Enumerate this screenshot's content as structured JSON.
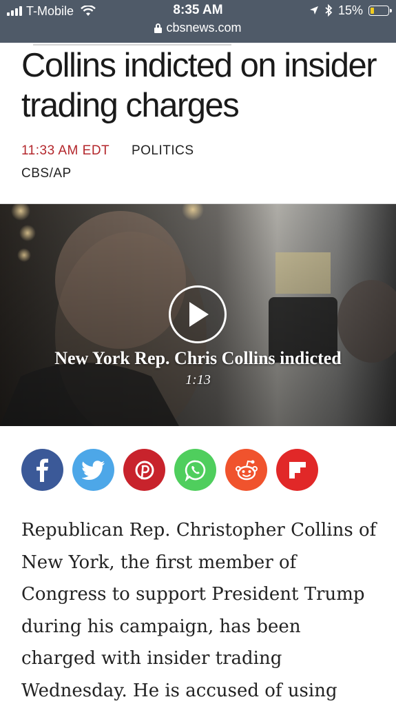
{
  "status_bar": {
    "carrier": "T-Mobile",
    "time": "8:35 AM",
    "url": "cbsnews.com",
    "battery_percent": "15%",
    "battery_level": 0.15,
    "icons": [
      "signal-icon",
      "wifi-icon",
      "lock-icon",
      "location-arrow-icon",
      "bluetooth-icon",
      "battery-icon"
    ]
  },
  "article": {
    "headline": "Collins indicted on insider trading charges",
    "time": "11:33 AM EDT",
    "category": "POLITICS",
    "source": "CBS/AP",
    "body": "Republican Rep. Christopher Collins of New York, the first member of Congress to support President Trump during his campaign, has been charged with insider trading Wednesday. He is accused of using"
  },
  "video": {
    "title": "New York Rep. Chris Collins indicted",
    "duration": "1:13"
  },
  "share": [
    {
      "network": "facebook",
      "icon": "facebook-icon",
      "color": "#3b5998"
    },
    {
      "network": "twitter",
      "icon": "twitter-icon",
      "color": "#4da7e8"
    },
    {
      "network": "pinterest",
      "icon": "pinterest-icon",
      "color": "#c8232c"
    },
    {
      "network": "whatsapp",
      "icon": "whatsapp-icon",
      "color": "#4fce5d"
    },
    {
      "network": "reddit",
      "icon": "reddit-icon",
      "color": "#f0532d"
    },
    {
      "network": "flipboard",
      "icon": "flipboard-icon",
      "color": "#e12828"
    }
  ],
  "colors": {
    "status_bar_bg": "#4f5a68",
    "meta_time": "#b3262b",
    "battery_fill": "#f2cc1f"
  }
}
